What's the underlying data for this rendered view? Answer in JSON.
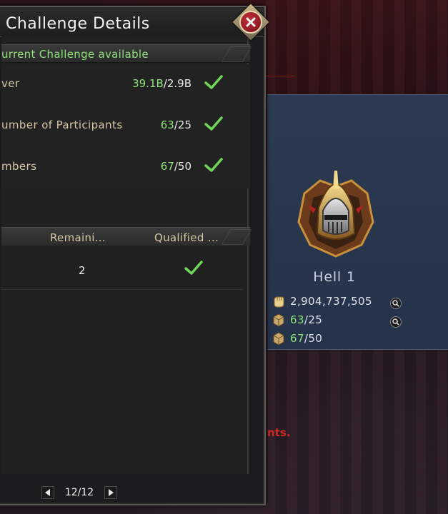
{
  "dialog": {
    "title": "Challenge Details",
    "section_header": "urrent Challenge available"
  },
  "requirements": [
    {
      "label": "ver",
      "current": "39.1B",
      "required": "/2.9B"
    },
    {
      "label": "umber of Participants",
      "current": "63",
      "required": "/25"
    },
    {
      "label": "mbers",
      "current": "67",
      "required": "/50"
    }
  ],
  "table": {
    "columns": [
      "Remaini...",
      "Qualified ..."
    ],
    "rows": [
      {
        "remaining": "2",
        "qualified": true
      }
    ]
  },
  "pager": {
    "text": "12/12"
  },
  "card": {
    "title": "Hell 1",
    "power": "2,904,737,505",
    "participants_current": "63",
    "participants_required": "/25",
    "members_current": "67",
    "members_required": "/50"
  },
  "background": {
    "text_fragment": "nts."
  },
  "colors": {
    "ok_green": "#8de27a",
    "label_gold": "#d6c7a4",
    "card_blue": "#2d3b52",
    "close_red": "#c0303a"
  }
}
